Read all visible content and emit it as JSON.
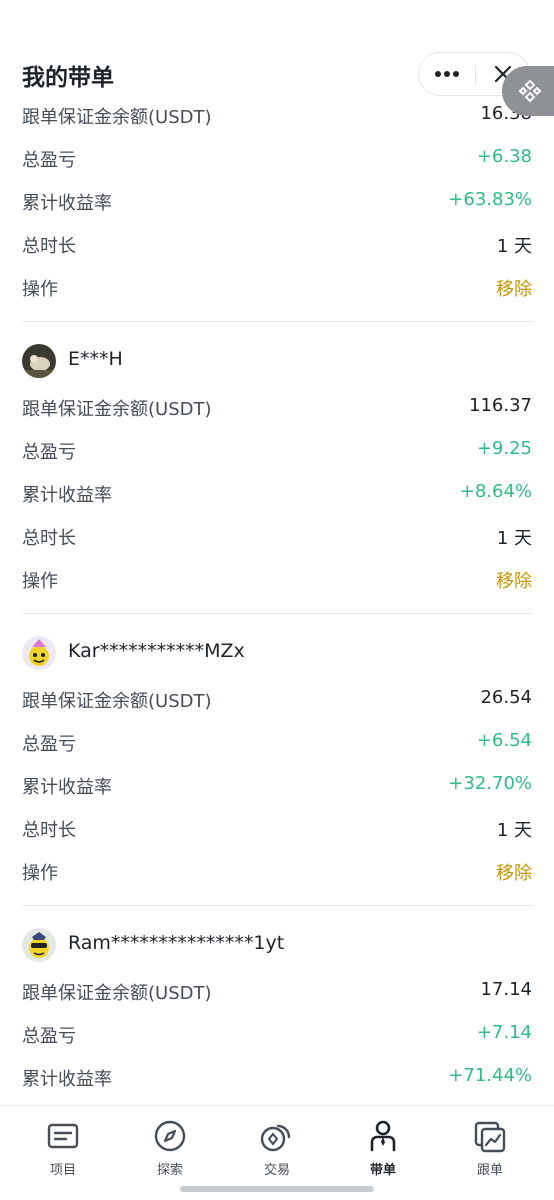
{
  "header": {
    "title": "我的带单"
  },
  "first_card": {
    "rows": [
      {
        "label": "跟单保证金余额(USDT)",
        "value": "16.38"
      },
      {
        "label": "总盈亏",
        "value": "+6.38"
      },
      {
        "label": "累计收益率",
        "value": "+63.83%"
      },
      {
        "label": "总时长",
        "value": "1 天"
      },
      {
        "label": "操作",
        "value": "移除"
      }
    ]
  },
  "cards": [
    {
      "name": "E***H",
      "rows": [
        {
          "label": "跟单保证金余额(USDT)",
          "value": "116.37"
        },
        {
          "label": "总盈亏",
          "value": "+9.25"
        },
        {
          "label": "累计收益率",
          "value": "+8.64%"
        },
        {
          "label": "总时长",
          "value": "1 天"
        },
        {
          "label": "操作",
          "value": "移除"
        }
      ]
    },
    {
      "name": "Kar***********MZx",
      "rows": [
        {
          "label": "跟单保证金余额(USDT)",
          "value": "26.54"
        },
        {
          "label": "总盈亏",
          "value": "+6.54"
        },
        {
          "label": "累计收益率",
          "value": "+32.70%"
        },
        {
          "label": "总时长",
          "value": "1 天"
        },
        {
          "label": "操作",
          "value": "移除"
        }
      ]
    },
    {
      "name": "Ram***************1yt",
      "rows": [
        {
          "label": "跟单保证金余额(USDT)",
          "value": "17.14"
        },
        {
          "label": "总盈亏",
          "value": "+7.14"
        },
        {
          "label": "累计收益率",
          "value": "+71.44%"
        }
      ]
    }
  ],
  "colors": {
    "profit": "#2ebd85",
    "action": "#c99400",
    "text": "#1e2329",
    "label": "#474d57"
  },
  "tabbar": {
    "items": [
      {
        "label": "项目",
        "icon": "list-icon"
      },
      {
        "label": "探索",
        "icon": "compass-icon"
      },
      {
        "label": "交易",
        "icon": "trade-icon"
      },
      {
        "label": "带单",
        "icon": "lead-person-icon",
        "active": true
      },
      {
        "label": "跟单",
        "icon": "copy-chart-icon"
      }
    ]
  }
}
